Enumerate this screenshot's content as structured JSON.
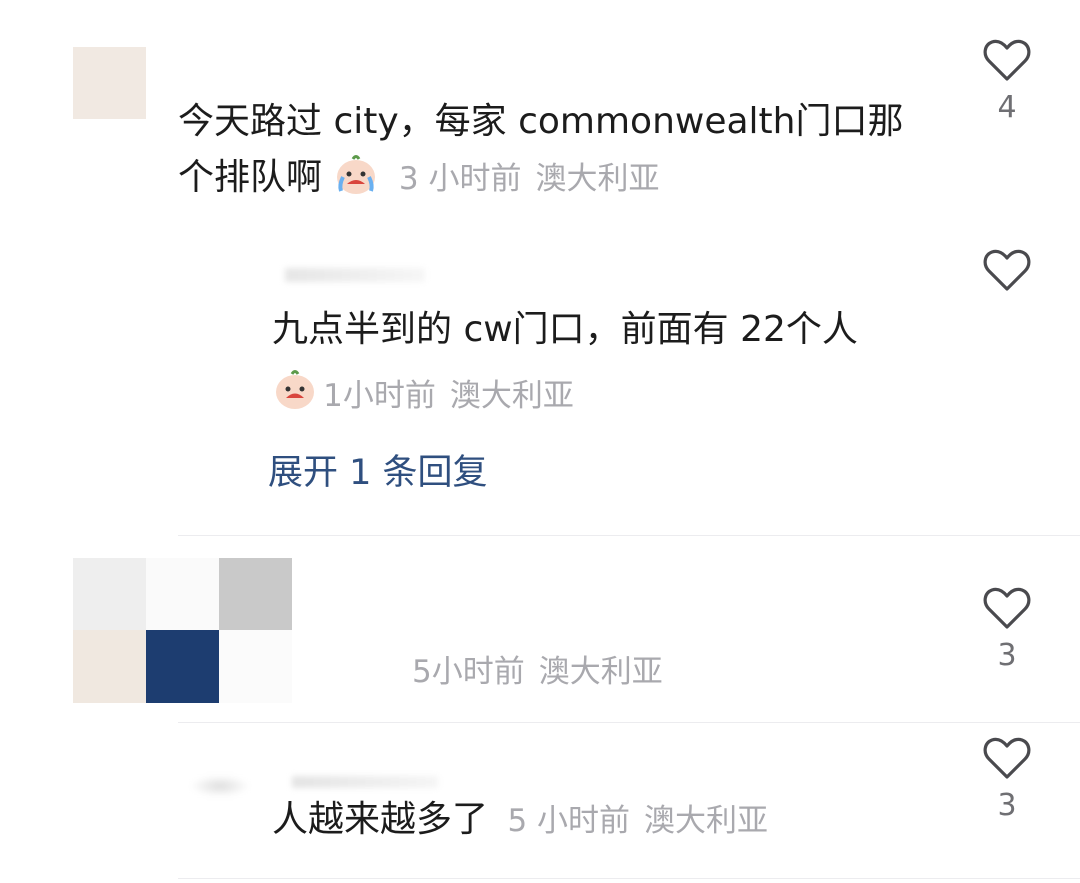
{
  "comments": [
    {
      "id": "c1",
      "text_line1": "今天路过 city，每家 commonwealth门口那",
      "text_line2": "个排队啊",
      "emoji": "crying-face-icon",
      "time": "3 小时前",
      "location": "澳大利亚",
      "likes": "4"
    },
    {
      "id": "r1",
      "text": "九点半到的 cw门口，前面有 22个人",
      "emoji": "crying-face-icon",
      "time": "1小时前",
      "location": "澳大利亚",
      "expand_label": "展开 1 条回复"
    },
    {
      "id": "c2",
      "time_partial": "5小时前",
      "location": "澳大利亚",
      "likes": "3"
    },
    {
      "id": "c3",
      "text": "人越来越多了",
      "time": "5 小时前",
      "location": "澳大利亚",
      "likes": "3"
    }
  ],
  "colors": {
    "text": "#1c1c1c",
    "meta": "#a9a9ae",
    "link": "#2f4f7f",
    "divider": "#ececef"
  }
}
